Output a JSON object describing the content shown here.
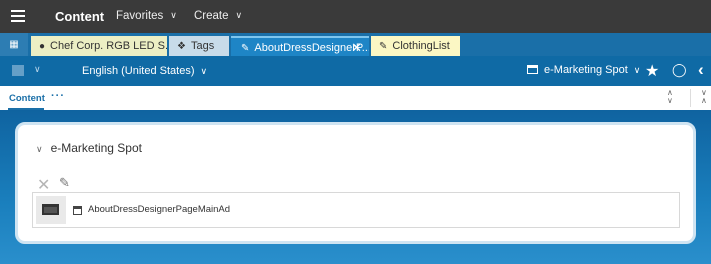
{
  "topbar": {
    "title": "Content",
    "menus": [
      {
        "label": "Favorites"
      },
      {
        "label": "Create"
      }
    ]
  },
  "tabs": [
    {
      "label": "Chef Corp. RGB LED S...",
      "icon": "globe-icon",
      "color": "#ecefc4"
    },
    {
      "label": "Tags",
      "icon": "tag-icon",
      "color": "#c8dbe9"
    },
    {
      "label": "AboutDressDesignerP...",
      "icon": "pencil-icon",
      "active": true,
      "color": "#1e85c6"
    },
    {
      "label": "ClothingList",
      "icon": "pencil-icon",
      "color": "#fbf7c4"
    }
  ],
  "toolbar": {
    "language": "English (United States)",
    "doc_type": "e-Marketing Spot"
  },
  "content_tab": {
    "label": "Content",
    "more": "···"
  },
  "section": {
    "title": "e-Marketing Spot",
    "item": {
      "label": "AboutDressDesignerPageMainAd",
      "icon": "marketing-spot-icon"
    }
  },
  "colors": {
    "topbar": "#3a3a3a",
    "accent": "#1a6fa8",
    "toolbar": "#0f6aa5"
  }
}
